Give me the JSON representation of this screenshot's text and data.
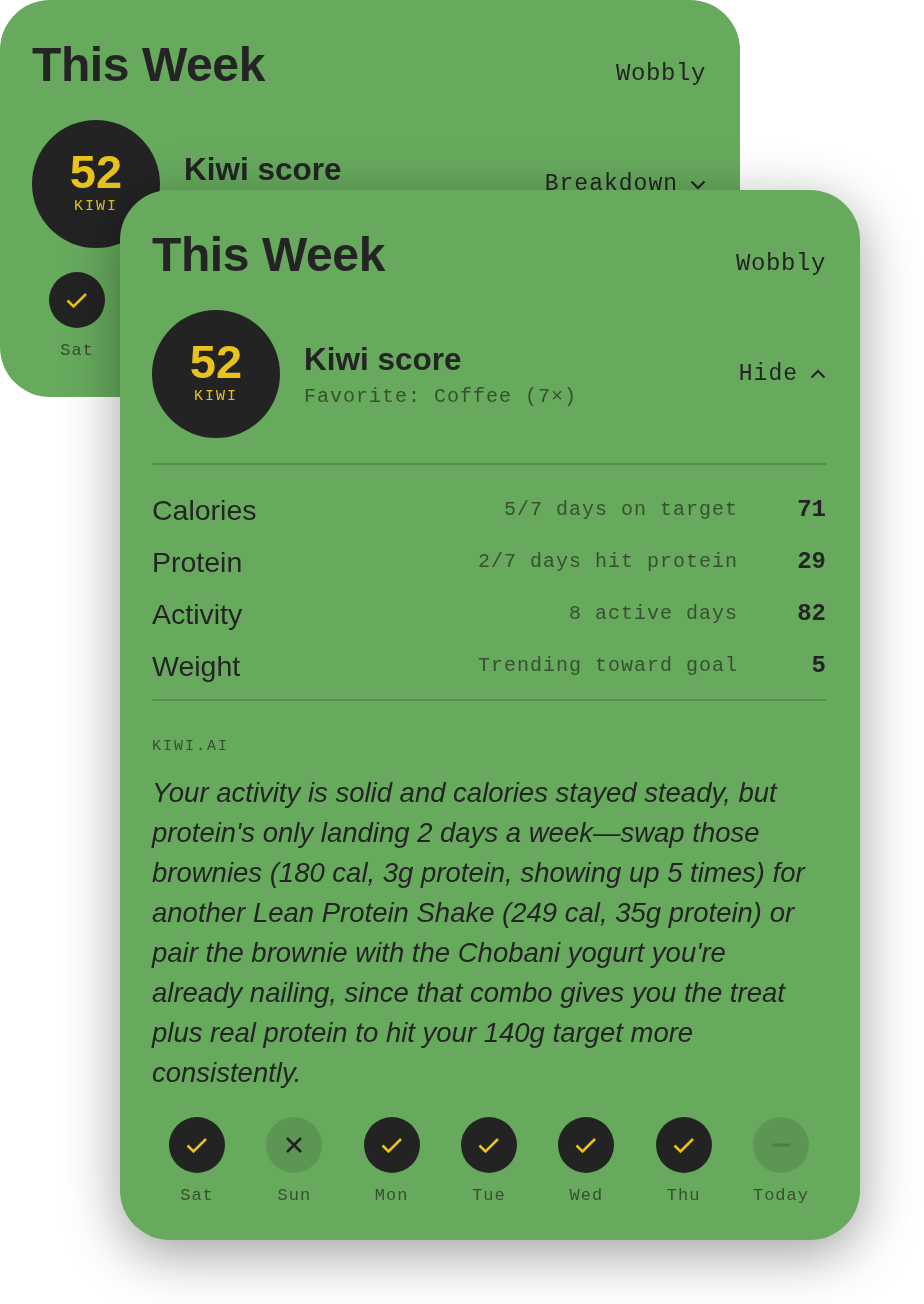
{
  "cards": [
    {
      "title": "This Week",
      "mood": "Wobbly",
      "score": {
        "value": "52",
        "unit": "KIWI"
      },
      "score_label": "Kiwi score",
      "toggle": {
        "label": "Breakdown",
        "expanded": false
      },
      "days": [
        {
          "label": "Sat",
          "kind": "hit"
        }
      ]
    },
    {
      "title": "This Week",
      "mood": "Wobbly",
      "score": {
        "value": "52",
        "unit": "KIWI"
      },
      "score_label": "Kiwi score",
      "favorite": "Favorite: Coffee (7×)",
      "toggle": {
        "label": "Hide",
        "expanded": true
      },
      "metrics": [
        {
          "name": "Calories",
          "detail": "5/7 days on target",
          "score": "71"
        },
        {
          "name": "Protein",
          "detail": "2/7 days hit protein",
          "score": "29"
        },
        {
          "name": "Activity",
          "detail": "8 active days",
          "score": "82"
        },
        {
          "name": "Weight",
          "detail": "Trending toward goal",
          "score": "5"
        }
      ],
      "insight": {
        "source": "KIWI.AI",
        "text": "Your activity is solid and calories stayed steady, but protein's only landing 2 days a week—swap those brownies (180 cal, 3g protein, showing up 5 times) for another Lean Protein Shake (249 cal, 35g protein) or pair the brownie with the Chobani yogurt you're already nailing, since that combo gives you the treat plus real protein to hit your 140g target more consistently."
      },
      "days": [
        {
          "label": "Sat",
          "kind": "hit"
        },
        {
          "label": "Sun",
          "kind": "missed"
        },
        {
          "label": "Mon",
          "kind": "hit"
        },
        {
          "label": "Tue",
          "kind": "hit"
        },
        {
          "label": "Wed",
          "kind": "hit"
        },
        {
          "label": "Thu",
          "kind": "hit"
        },
        {
          "label": "Today",
          "kind": "pending"
        }
      ]
    }
  ]
}
